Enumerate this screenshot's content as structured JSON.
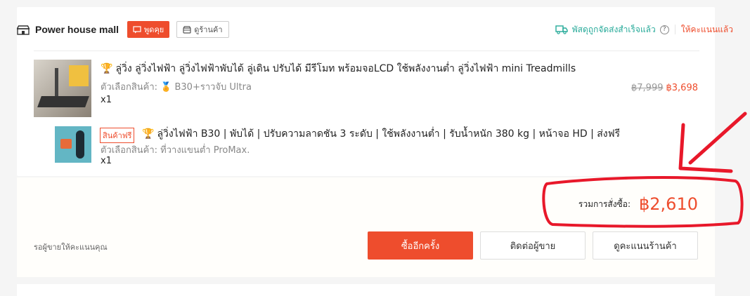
{
  "shop": {
    "name": "Power house mall",
    "chat_label": "พูดคุย",
    "view_shop_label": "ดูร้านค้า"
  },
  "status": {
    "delivered_text": "พัสดุถูกจัดส่งสำเร็จแล้ว",
    "help_glyph": "?",
    "rated_text": "ให้คะแนนแล้ว"
  },
  "items": [
    {
      "title": "ลู่วิ่ง ลู่วิ่งไฟฟ้า ลู่วิ่งไฟฟ้าพับได้ ลู่เดิน ปรับได้ มีรีโมท พร้อมจอLCD ใช้พลังงานต่ำ ลู่วิ่งไฟฟ้า mini Treadmills",
      "variation": "ตัวเลือกสินค้า: 🏅 B30+ราวจับ Ultra",
      "qty": "x1",
      "old_price": "฿7,999",
      "new_price": "฿3,698"
    },
    {
      "badge": "สินค้าฟรี",
      "title": "ลู่วิ่งไฟฟ้า B30 | พับได้ | ปรับความลาดชัน 3 ระดับ | ใช้พลังงานต่ำ | รับน้ำหนัก 380 kg | หน้าจอ HD | ส่งฟรี",
      "variation": "ตัวเลือกสินค้า: ที่วางแขนต่ำ ProMax.",
      "qty": "x1"
    }
  ],
  "summary": {
    "total_label": "รวมการสั่งซื้อ:",
    "total_value": "฿2,610",
    "waiting_text": "รอผู้ขายให้คะแนนคุณ",
    "buy_again": "ซื้ออีกครั้ง",
    "contact_seller": "ติดต่อผู้ขาย",
    "rate_shop": "ดูคะแนนร้านค้า"
  },
  "colors": {
    "accent": "#ee4d2d",
    "delivered": "#26aa99",
    "annotation": "#e8182a"
  },
  "icons": [
    "shop-icon",
    "chat-icon",
    "store-icon",
    "truck-icon",
    "help-icon",
    "trophy-icon"
  ]
}
